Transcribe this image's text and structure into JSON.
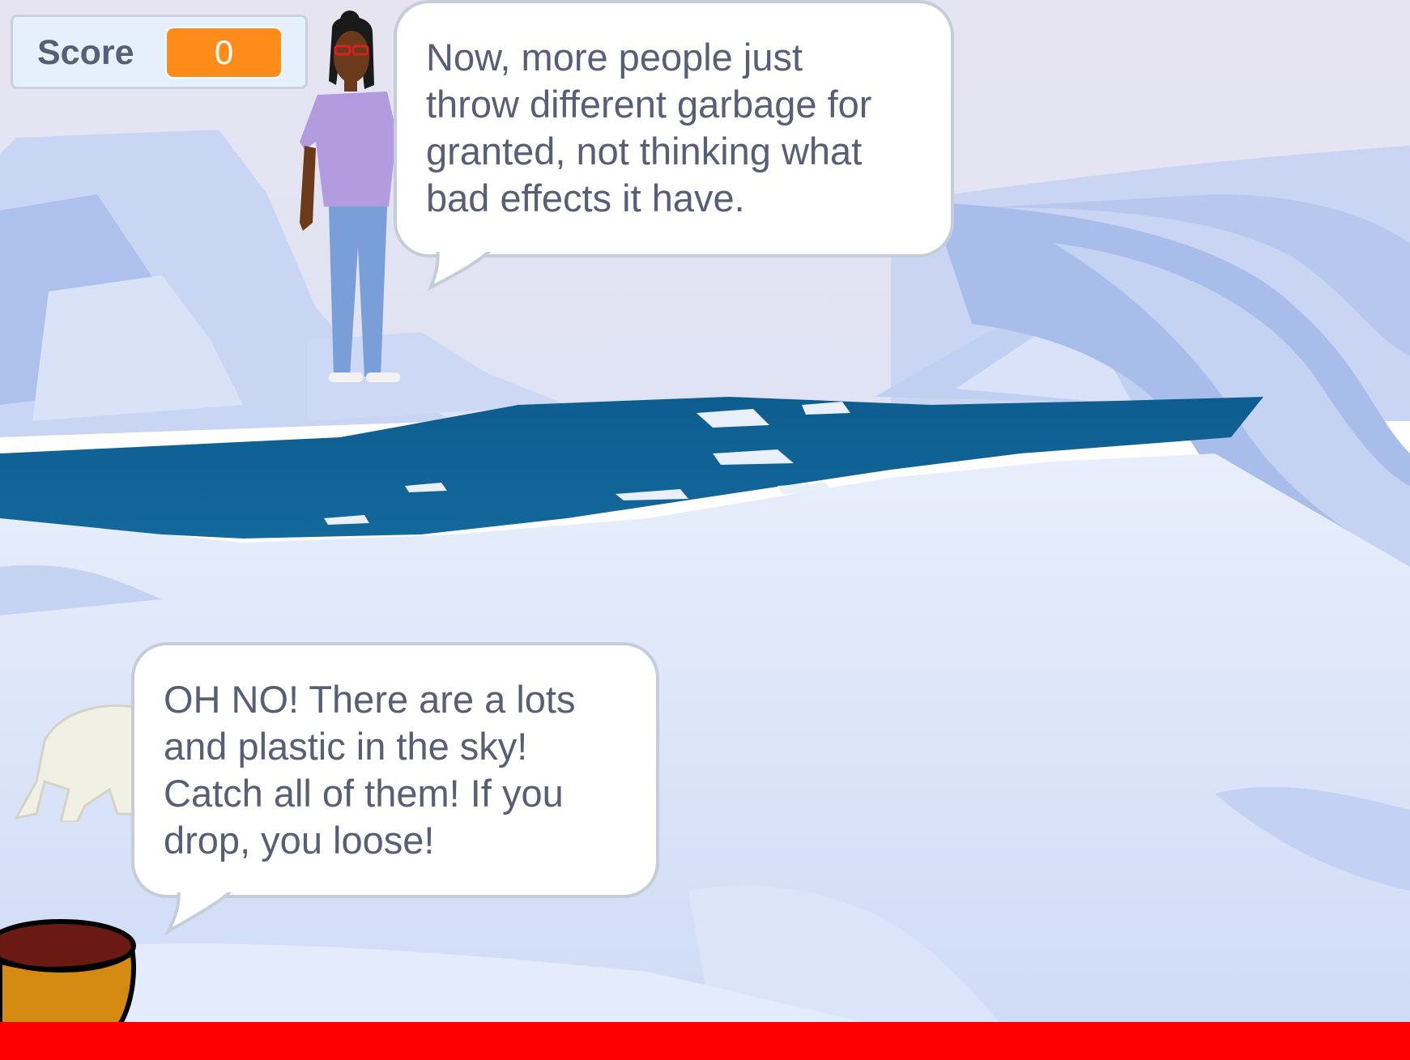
{
  "score_monitor": {
    "label": "Score",
    "value": "0"
  },
  "speech_bubbles": {
    "girl": "Now, more people just\nthrow different garbage for\ngranted, not thinking what\nbad effects it have.",
    "bear": "OH NO! There are a lots\nand plastic in the sky!\nCatch all of them! If you\ndrop, you loose!"
  },
  "sprites": {
    "girl": "girl-character",
    "bear": "polar-bear",
    "basket": "basket",
    "floor": "red-ground-line"
  },
  "colors": {
    "score_value_bg": "#ff8c1a",
    "bubble_text": "#575e75",
    "floor_bar": "#ff0000",
    "sky": "#e4e6f3",
    "water": "#0b5286"
  }
}
